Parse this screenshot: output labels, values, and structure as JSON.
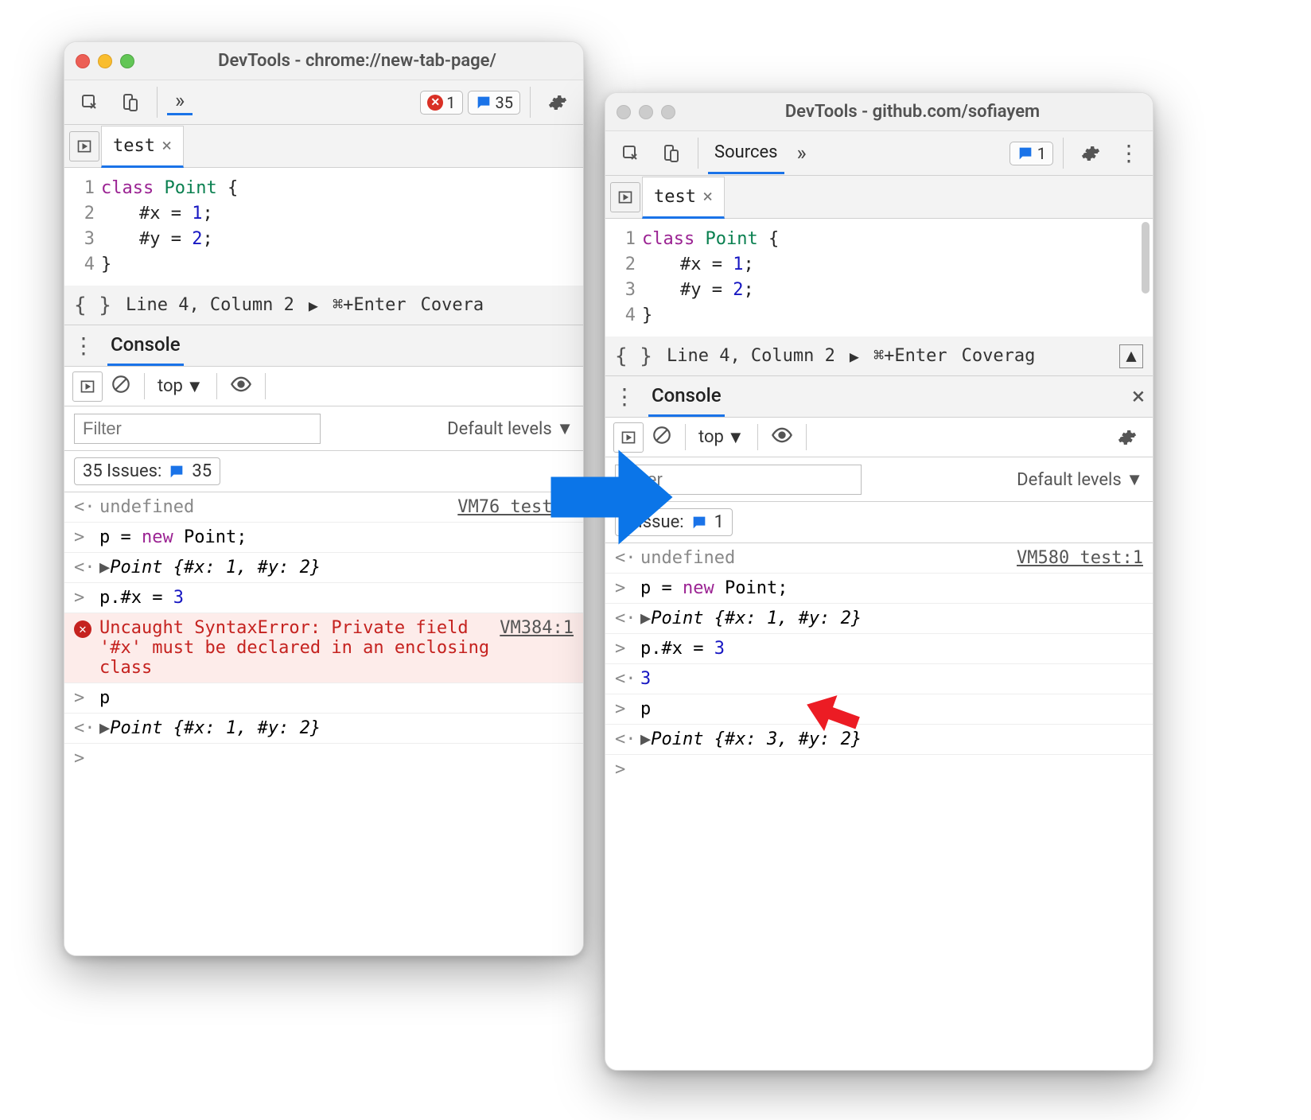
{
  "left": {
    "title": "DevTools - chrome://new-tab-page/",
    "errors_count": "1",
    "messages_count": "35",
    "tab_name": "test",
    "code_lines": [
      "1",
      "2",
      "3",
      "4"
    ],
    "code": {
      "l1a": "class",
      "l1b": "Point",
      "l1c": "{",
      "l2a": "#x = ",
      "l2b": "1",
      "l2c": ";",
      "l3a": "#y = ",
      "l3b": "2",
      "l3c": ";",
      "l4": "}"
    },
    "status_line": "Line 4, Column 2",
    "status_run": "⌘+Enter",
    "status_cov": "Covera",
    "console_label": "Console",
    "ctx": "top",
    "levels": "Default levels",
    "filter_placeholder": "Filter",
    "issues_label": "35 Issues:",
    "issues_count": "35",
    "log": {
      "r1": "undefined",
      "r1_src": "VM76 test:1",
      "r2a": "p = ",
      "r2b": "new",
      "r2c": " Point;",
      "r3": "Point {#x: 1, #y: 2}",
      "r4a": "p.#x = ",
      "r4b": "3",
      "r5": "Uncaught SyntaxError: Private field '#x' must be declared in an enclosing class",
      "r5_src": "VM384:1",
      "r6": "p",
      "r7": "Point {#x: 1, #y: 2}"
    }
  },
  "right": {
    "title": "DevTools - github.com/sofiayem",
    "messages_count": "1",
    "sources_label": "Sources",
    "tab_name": "test",
    "code_lines": [
      "1",
      "2",
      "3",
      "4"
    ],
    "code": {
      "l1a": "class",
      "l1b": "Point",
      "l1c": "{",
      "l2a": "#x = ",
      "l2b": "1",
      "l2c": ";",
      "l3a": "#y = ",
      "l3b": "2",
      "l3c": ";",
      "l4": "}"
    },
    "status_line": "Line 4, Column 2",
    "status_run": "⌘+Enter",
    "status_cov": "Coverag",
    "console_label": "Console",
    "ctx": "top",
    "levels": "Default levels",
    "filter_placeholder": "Filter",
    "issues_label": "1 Issue:",
    "issues_count": "1",
    "log": {
      "r1": "undefined",
      "r1_src": "VM580 test:1",
      "r2a": "p = ",
      "r2b": "new",
      "r2c": " Point;",
      "r3": "Point {#x: 1, #y: 2}",
      "r4a": "p.#x = ",
      "r4b": "3",
      "r5": "3",
      "r6": "p",
      "r7": "Point {#x: 3, #y: 2}"
    }
  }
}
